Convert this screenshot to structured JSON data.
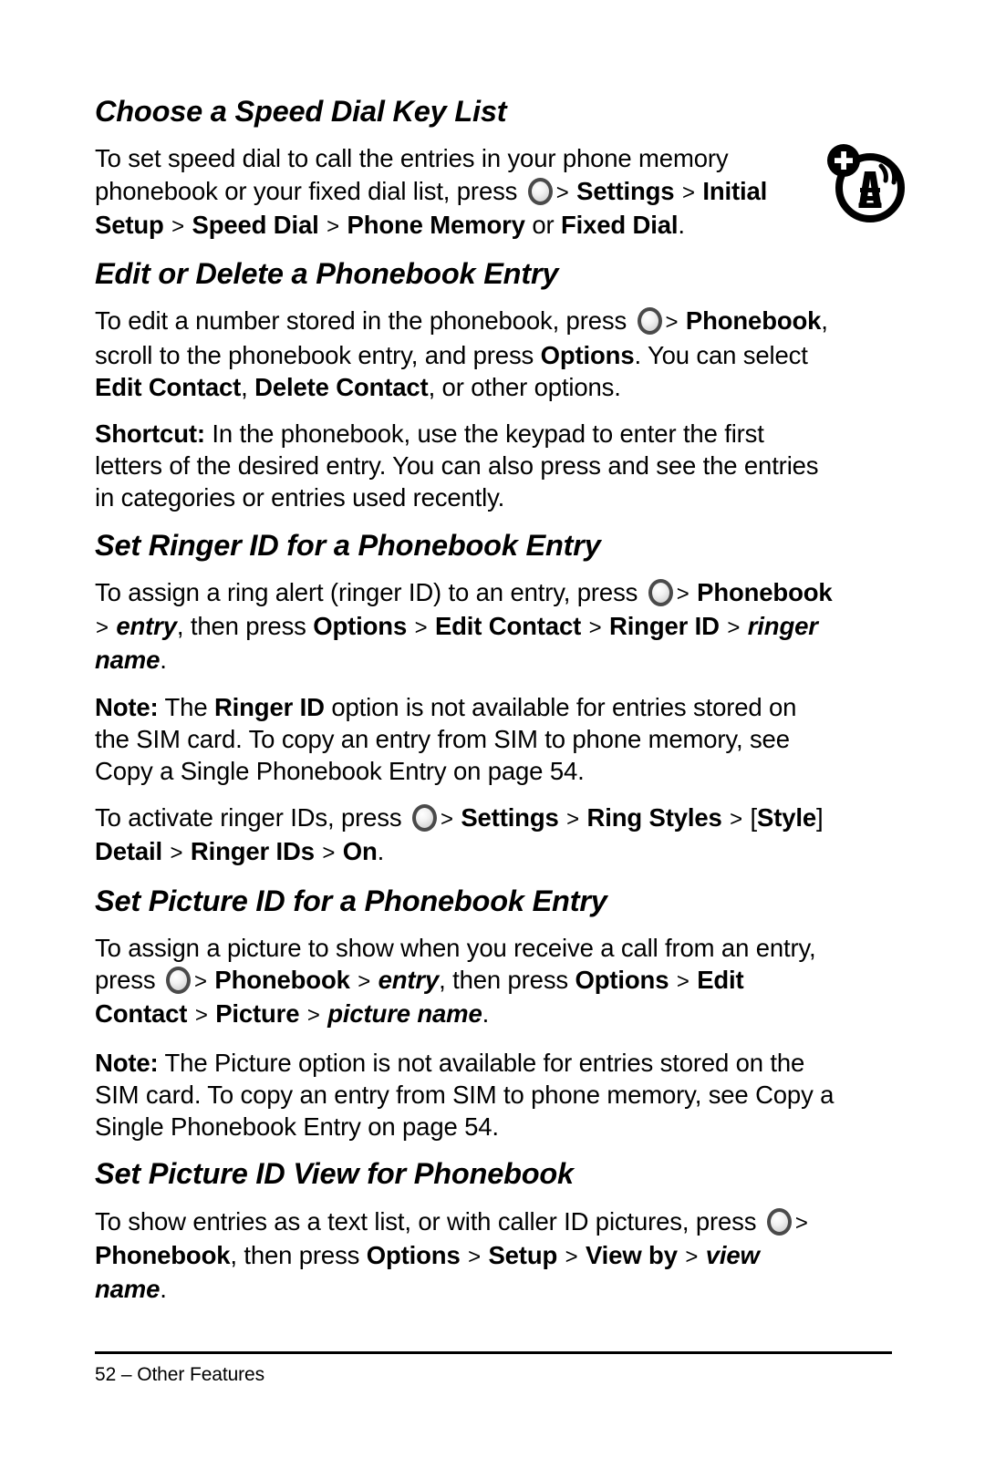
{
  "document": {
    "page_number": "52",
    "footer": "52 – Other Features",
    "icon_name": "cellular-tower-plus-icon",
    "menu_key_icon_name": "menu-key-icon"
  },
  "sections": [
    {
      "id": "choose-speed-dial-key-list",
      "heading": "Choose a Speed Dial Key List",
      "paragraphs": [
        {
          "runs": [
            {
              "t": "To set speed dial to call the entries in your phone memory phonebook or your fixed dial list, press ",
              "s": "normal"
            },
            {
              "t": "",
              "s": "menukey"
            },
            {
              "t": ">",
              "s": "chev"
            },
            {
              "t": "Settings",
              "s": "bold"
            },
            {
              "t": ">",
              "s": "chev"
            },
            {
              "t": "Initial Setup",
              "s": "bold"
            },
            {
              "t": ">",
              "s": "chev"
            },
            {
              "t": "Speed Dial",
              "s": "bold"
            },
            {
              "t": ">",
              "s": "chev"
            },
            {
              "t": "Phone Memory",
              "s": "bold"
            },
            {
              "t": " or ",
              "s": "normal"
            },
            {
              "t": "Fixed Dial",
              "s": "bold"
            },
            {
              "t": ".",
              "s": "normal"
            }
          ]
        }
      ]
    },
    {
      "id": "edit-or-delete-a-phonebook-entry",
      "heading": "Edit or Delete a Phonebook Entry",
      "paragraphs": [
        {
          "runs": [
            {
              "t": "To edit a number stored in the phonebook, press ",
              "s": "normal"
            },
            {
              "t": "",
              "s": "menukey"
            },
            {
              "t": ">",
              "s": "chev"
            },
            {
              "t": "Phonebook",
              "s": "bold"
            },
            {
              "t": ", scroll to the phonebook entry, and press ",
              "s": "normal"
            },
            {
              "t": "Options",
              "s": "bold"
            },
            {
              "t": ". You can select ",
              "s": "normal"
            },
            {
              "t": "Edit Contact",
              "s": "bold"
            },
            {
              "t": ", ",
              "s": "normal"
            },
            {
              "t": "Delete Contact",
              "s": "bold"
            },
            {
              "t": ", or other options.",
              "s": "normal"
            }
          ]
        },
        {
          "runs": [
            {
              "t": "Shortcut:",
              "s": "bold"
            },
            {
              "t": " In the phonebook, use the keypad to enter the first letters of the desired entry. You can also press and see the entries in categories or entries used recently.",
              "s": "normal"
            }
          ]
        }
      ]
    },
    {
      "id": "set-ringer-id-for-a-phonebook-entry",
      "heading": "Set Ringer ID for a Phonebook Entry",
      "paragraphs": [
        {
          "runs": [
            {
              "t": "To assign a ring alert (ringer ID) to an entry, press ",
              "s": "normal"
            },
            {
              "t": "",
              "s": "menukey"
            },
            {
              "t": ">",
              "s": "chev"
            },
            {
              "t": "Phonebook",
              "s": "bold"
            },
            {
              "t": ">",
              "s": "chev"
            },
            {
              "t": "entry",
              "s": "bolditalic"
            },
            {
              "t": ", then press ",
              "s": "normal"
            },
            {
              "t": "Options",
              "s": "bold"
            },
            {
              "t": ">",
              "s": "chev"
            },
            {
              "t": "Edit Contact",
              "s": "bold"
            },
            {
              "t": ">",
              "s": "chev"
            },
            {
              "t": "Ringer ID",
              "s": "bold"
            },
            {
              "t": ">",
              "s": "chev"
            },
            {
              "t": "ringer name",
              "s": "bolditalic"
            },
            {
              "t": ".",
              "s": "normal"
            }
          ]
        },
        {
          "runs": [
            {
              "t": "Note:",
              "s": "bold"
            },
            {
              "t": " The ",
              "s": "normal"
            },
            {
              "t": "Ringer ID",
              "s": "bold"
            },
            {
              "t": " option is not available for entries stored on the SIM card. To copy an entry from SIM to phone memory, see Copy a Single Phonebook Entry on page 54.",
              "s": "normal"
            }
          ]
        },
        {
          "runs": [
            {
              "t": "To activate ringer IDs, press ",
              "s": "normal"
            },
            {
              "t": "",
              "s": "menukey"
            },
            {
              "t": ">",
              "s": "chev"
            },
            {
              "t": "Settings",
              "s": "bold"
            },
            {
              "t": ">",
              "s": "chev"
            },
            {
              "t": "Ring Styles",
              "s": "bold"
            },
            {
              "t": ">",
              "s": "chev"
            },
            {
              "t": "[",
              "s": "normal"
            },
            {
              "t": "Style",
              "s": "bold"
            },
            {
              "t": "]",
              "s": "normal"
            },
            {
              "t": " ",
              "s": "normal"
            },
            {
              "t": "Detail",
              "s": "bold"
            },
            {
              "t": ">",
              "s": "chev"
            },
            {
              "t": "Ringer IDs",
              "s": "bold"
            },
            {
              "t": ">",
              "s": "chev"
            },
            {
              "t": "On",
              "s": "bold"
            },
            {
              "t": ".",
              "s": "normal"
            }
          ]
        }
      ]
    },
    {
      "id": "set-picture-id-for-a-phonebook-entry",
      "heading": "Set Picture ID for a Phonebook Entry",
      "paragraphs": [
        {
          "runs": [
            {
              "t": "To assign a picture to show when you receive a call from an entry, press ",
              "s": "normal"
            },
            {
              "t": "",
              "s": "menukey"
            },
            {
              "t": ">",
              "s": "chev"
            },
            {
              "t": "Phonebook",
              "s": "bold"
            },
            {
              "t": ">",
              "s": "chev"
            },
            {
              "t": "entry",
              "s": "bolditalic"
            },
            {
              "t": ", then press ",
              "s": "normal"
            },
            {
              "t": "Options",
              "s": "bold"
            },
            {
              "t": ">",
              "s": "chev"
            },
            {
              "t": "Edit Contact",
              "s": "bold"
            },
            {
              "t": ">",
              "s": "chev"
            },
            {
              "t": "Picture",
              "s": "bold"
            },
            {
              "t": ">",
              "s": "chev"
            },
            {
              "t": "picture name",
              "s": "bolditalic"
            },
            {
              "t": ".",
              "s": "normal"
            }
          ]
        },
        {
          "runs": [
            {
              "t": "Note:",
              "s": "bold"
            },
            {
              "t": " The Picture option is not available for entries stored on the SIM card. To copy an entry from SIM to phone memory, see Copy a Single Phonebook Entry on page 54.",
              "s": "normal"
            }
          ]
        }
      ]
    },
    {
      "id": "set-picture-id-view-for-phonebook",
      "heading": "Set Picture ID View for Phonebook",
      "paragraphs": [
        {
          "runs": [
            {
              "t": "To show entries as a text list, or with caller ID pictures, press ",
              "s": "normal"
            },
            {
              "t": "",
              "s": "menukey"
            },
            {
              "t": ">",
              "s": "chev"
            },
            {
              "t": "Phonebook",
              "s": "bold"
            },
            {
              "t": ", then press ",
              "s": "normal"
            },
            {
              "t": "Options",
              "s": "bold"
            },
            {
              "t": ">",
              "s": "chev"
            },
            {
              "t": "Setup",
              "s": "bold"
            },
            {
              "t": ">",
              "s": "chev"
            },
            {
              "t": "View by",
              "s": "bold"
            },
            {
              "t": ">",
              "s": "chev"
            },
            {
              "t": "view name",
              "s": "bolditalic"
            },
            {
              "t": ".",
              "s": "normal"
            }
          ]
        }
      ]
    }
  ]
}
